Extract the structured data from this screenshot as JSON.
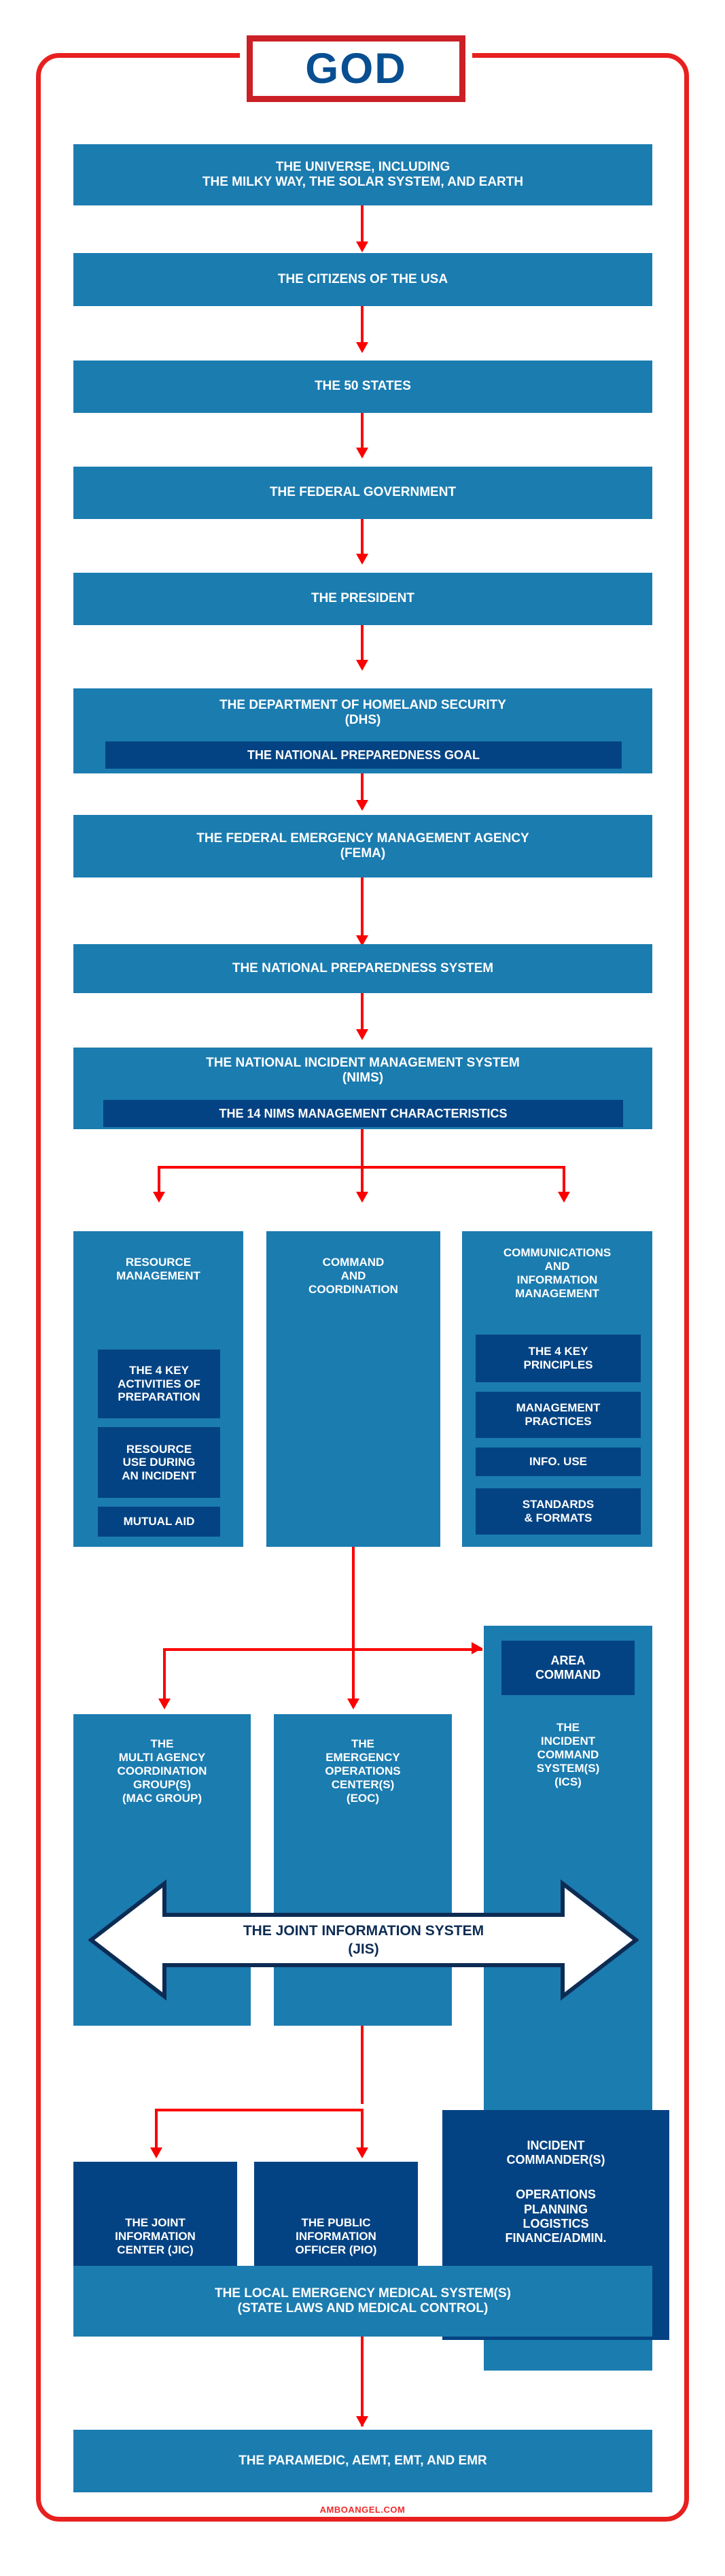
{
  "title": {
    "label": "GOD"
  },
  "colors": {
    "frame_red": "#e8201f",
    "arrow_red": "#fb0000",
    "box_blue": "#1b7cb0",
    "box_navy": "#044383",
    "title_blue": "#084f92",
    "text_white": "#ffffff",
    "footer_red": "#ef2b2b"
  },
  "chain": [
    {
      "id": "universe",
      "lines": [
        "THE UNIVERSE, INCLUDING",
        "THE MILKY WAY, THE SOLAR SYSTEM, AND EARTH"
      ]
    },
    {
      "id": "citizens",
      "lines": [
        "THE CITIZENS OF THE USA"
      ]
    },
    {
      "id": "states",
      "lines": [
        "THE 50 STATES"
      ]
    },
    {
      "id": "federal-government",
      "lines": [
        "THE FEDERAL GOVERNMENT"
      ]
    },
    {
      "id": "president",
      "lines": [
        "THE PRESIDENT"
      ]
    },
    {
      "id": "dhs",
      "lines": [
        "THE DEPARTMENT OF HOMELAND SECURITY",
        "(DHS)"
      ],
      "sub": "THE NATIONAL PREPAREDNESS GOAL"
    },
    {
      "id": "fema",
      "lines": [
        "THE FEDERAL EMERGENCY MANAGEMENT AGENCY",
        "(FEMA)"
      ]
    },
    {
      "id": "nps",
      "lines": [
        "THE NATIONAL PREPAREDNESS SYSTEM"
      ]
    },
    {
      "id": "nims",
      "lines": [
        "THE NATIONAL INCIDENT MANAGEMENT SYSTEM",
        "(NIMS)"
      ],
      "sub": "THE 14 NIMS MANAGEMENT CHARACTERISTICS"
    }
  ],
  "nims_components": [
    {
      "id": "resource-management",
      "title_lines": [
        "RESOURCE",
        "MANAGEMENT"
      ],
      "subs": [
        "THE 4 KEY\nACTIVITIES OF\nPREPARATION",
        "RESOURCE\nUSE DURING\nAN INCIDENT",
        "MUTUAL AID"
      ]
    },
    {
      "id": "command-and-coordination",
      "title_lines": [
        "COMMAND",
        "AND",
        "COORDINATION"
      ],
      "subs": []
    },
    {
      "id": "communications-and-information-management",
      "title_lines": [
        "COMMUNICATIONS",
        "AND",
        "INFORMATION",
        "MANAGEMENT"
      ],
      "subs": [
        "THE 4 KEY\nPRINCIPLES",
        "MANAGEMENT\nPRACTICES",
        "INFO. USE",
        "STANDARDS\n&  FORMATS"
      ]
    }
  ],
  "coordination_row": {
    "area_command": "AREA\nCOMMAND",
    "mac": [
      "THE",
      "MULTI AGENCY",
      "COORDINATION",
      "GROUP(S)",
      "(MAC GROUP)"
    ],
    "eoc": [
      "THE",
      "EMERGENCY",
      "OPERATIONS",
      "CENTER(S)",
      "(EOC)"
    ],
    "ics": [
      "THE",
      "INCIDENT",
      "COMMAND",
      "SYSTEM(S)",
      "(ICS)"
    ]
  },
  "jis": {
    "line1": "THE JOINT INFORMATION SYSTEM",
    "line2": "(JIS)"
  },
  "information_row": {
    "jic": [
      "THE JOINT",
      "INFORMATION",
      "CENTER (JIC)"
    ],
    "pio": [
      "THE PUBLIC",
      "INFORMATION",
      "OFFICER (PIO)"
    ],
    "incident_commander": {
      "heading": [
        "INCIDENT",
        "COMMANDER(S)"
      ],
      "sections": [
        "OPERATIONS",
        "PLANNING",
        "LOGISTICS",
        "FINANCE/ADMIN."
      ]
    }
  },
  "ems": {
    "lines": [
      "THE LOCAL EMERGENCY MEDICAL SYSTEM(S)",
      "(STATE LAWS AND MEDICAL CONTROL)"
    ]
  },
  "providers": {
    "lines": [
      "THE PARAMEDIC, AEMT, EMT, AND EMR"
    ]
  },
  "footer": {
    "label": "AMBOANGEL.COM"
  }
}
